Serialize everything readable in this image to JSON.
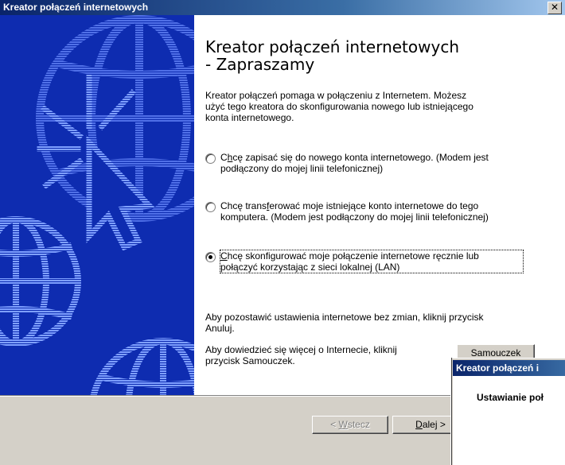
{
  "window": {
    "title": "Kreator połączeń internetowych",
    "close_glyph": "✕",
    "close_icon": "close-icon"
  },
  "banner": {
    "background": "#0e2cb0",
    "art": "globe-and-cursor-illustration"
  },
  "page": {
    "heading_line1": "Kreator połączeń internetowych",
    "heading_line2": "- Zapraszamy",
    "intro_line1": "Kreator połączeń pomaga w połączeniu z Internetem. Możesz",
    "intro_line2": "użyć tego kreatora do skonfigurowania nowego lub istniejącego",
    "intro_line3": "konta internetowego."
  },
  "options": [
    {
      "line1_pre": "C",
      "line1_ul": "h",
      "line1_post": "cę zapisać się do nowego konta internetowego. (Modem jest",
      "line2": "podłączony do mojej linii telefonicznej)",
      "selected": false
    },
    {
      "line1_pre": "Chcę trans",
      "line1_ul": "f",
      "line1_post": "erować moje istniejące konto internetowe do tego",
      "line2": "komputera. (Modem jest podłączony do mojej linii telefonicznej)",
      "selected": false
    },
    {
      "line1_pre": "",
      "line1_ul": "C",
      "line1_post": "hcę skonfigurować moje połączenie internetowe ręcznie lub",
      "line2": "połączyć korzystając z sieci lokalnej (LAN)",
      "selected": true
    }
  ],
  "notes": {
    "cancel_line1": "Aby pozostawić ustawienia internetowe bez zmian, kliknij przycisk",
    "cancel_line2": "Anuluj.",
    "tutorial_line1": "Aby dowiedzieć się więcej o Internecie, kliknij",
    "tutorial_line2": "przycisk Samouczek."
  },
  "buttons": {
    "tutorial": "Samouczek",
    "back_pre": "< ",
    "back_ul": "W",
    "back_post": "stecz",
    "next_ul": "D",
    "next_post": "alej >"
  },
  "overlay_dialog": {
    "title": "Kreator połączeń i",
    "body": "Ustawianie poł"
  }
}
